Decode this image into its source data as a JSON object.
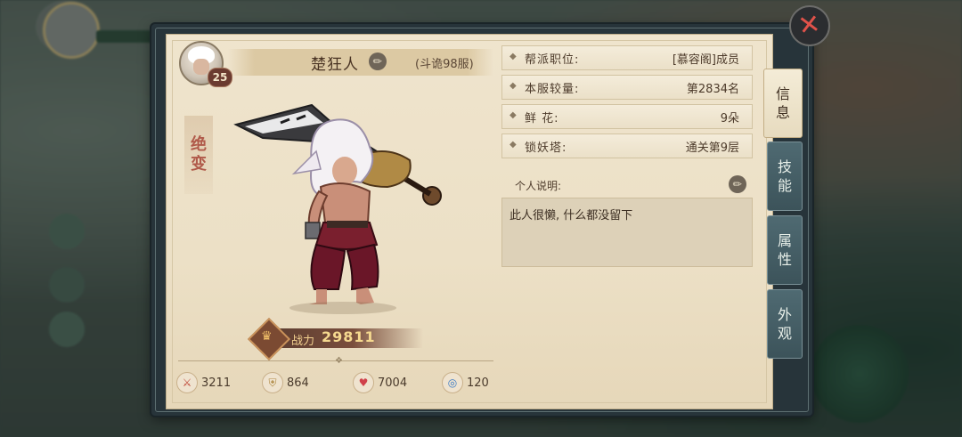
{
  "character": {
    "name": "楚狂人",
    "server": "(斗诡98服)",
    "level": "25",
    "title": "绝\n变",
    "power_label": "战力",
    "power_value": "29811"
  },
  "stats": [
    {
      "icon": "attack-icon",
      "value": "3211"
    },
    {
      "icon": "defense-icon",
      "value": "864"
    },
    {
      "icon": "health-icon",
      "value": "7004"
    },
    {
      "icon": "speed-icon",
      "value": "120"
    }
  ],
  "info": [
    {
      "label": "帮派职位:",
      "value": "[慕容阁]成员"
    },
    {
      "label": "本服较量:",
      "value": "第2834名"
    },
    {
      "label": "鲜 花:",
      "value": "9朵"
    },
    {
      "label": "锁妖塔:",
      "value": "通关第9层"
    }
  ],
  "bio": {
    "label": "个人说明:",
    "text": "此人很懒, 什么都没留下"
  },
  "tabs": [
    {
      "label": "信\n息",
      "active": true
    },
    {
      "label": "技\n能",
      "active": false
    },
    {
      "label": "属\n性",
      "active": false
    },
    {
      "label": "外\n观",
      "active": false
    }
  ],
  "close_glyph": "✕"
}
